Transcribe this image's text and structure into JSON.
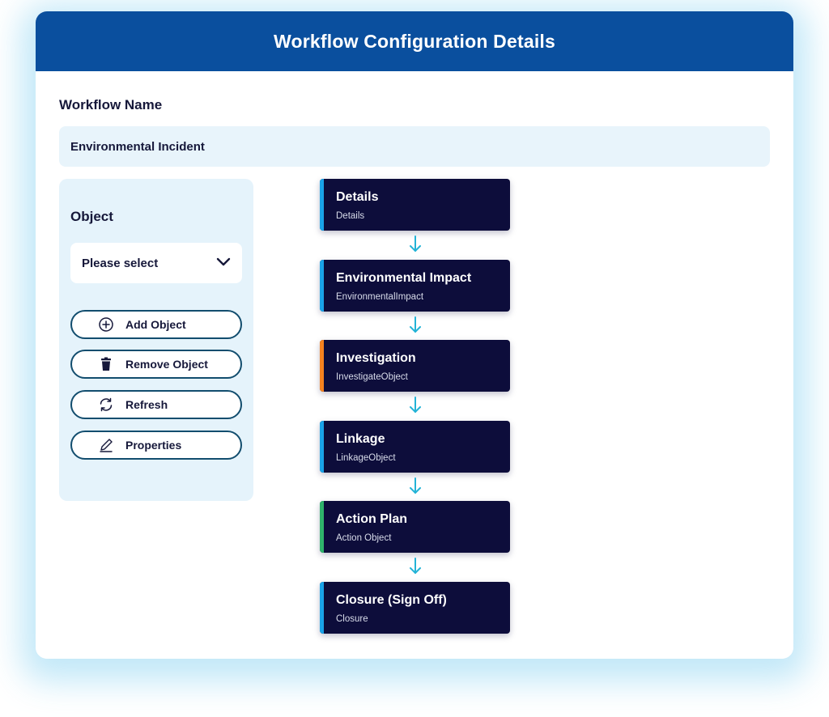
{
  "header": {
    "title": "Workflow Configuration Details"
  },
  "workflow": {
    "label": "Workflow Name",
    "value": "Environmental Incident"
  },
  "object_panel": {
    "label": "Object",
    "select_value": "Please select",
    "buttons": [
      {
        "label": "Add Object",
        "icon": "plus-circle-icon"
      },
      {
        "label": "Remove Object",
        "icon": "trash-icon"
      },
      {
        "label": "Refresh",
        "icon": "refresh-icon"
      },
      {
        "label": "Properties",
        "icon": "pencil-icon"
      }
    ]
  },
  "steps": [
    {
      "name": "Details",
      "sub": "Details",
      "accent": "#1aa3e8"
    },
    {
      "name": "Environmental Impact",
      "sub": "EnvironmentalImpact",
      "accent": "#1aa3e8"
    },
    {
      "name": "Investigation",
      "sub": "InvestigateObject",
      "accent": "#f5821f"
    },
    {
      "name": "Linkage",
      "sub": "LinkageObject",
      "accent": "#1aa3e8"
    },
    {
      "name": "Action Plan",
      "sub": "Action Object",
      "accent": "#2fb36b"
    },
    {
      "name": "Closure (Sign Off)",
      "sub": "Closure",
      "accent": "#1aa3e8"
    }
  ],
  "colors": {
    "header_bg": "#0a4f9e",
    "step_bg": "#0d0d3b",
    "arrow": "#23b3d6",
    "button_border": "#124d6e"
  }
}
